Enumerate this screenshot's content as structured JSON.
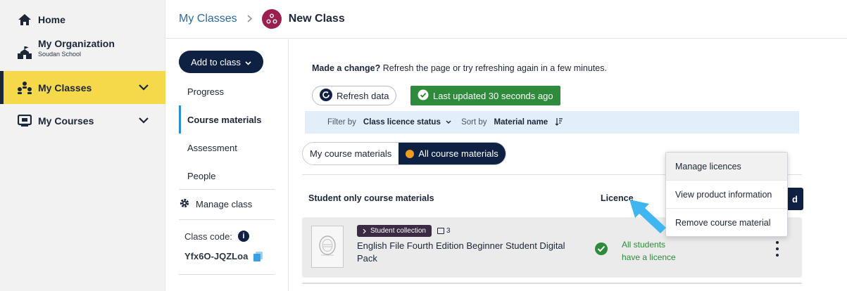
{
  "nav": {
    "home": "Home",
    "org_name": "My Organization",
    "org_school": "Soudan School",
    "classes": "My Classes",
    "courses": "My Courses"
  },
  "header": {
    "breadcrumb_parent": "My Classes",
    "breadcrumb_current": "New Class"
  },
  "class_nav": {
    "add_button": "Add to class",
    "items": [
      "Progress",
      "Course materials",
      "Assessment",
      "People"
    ],
    "manage": "Manage class",
    "code_label": "Class code:",
    "code_value": "Yfx6O-JQZLoa"
  },
  "main": {
    "notice_bold": "Made a change?",
    "notice_text": " Refresh the page or try refreshing again in a few minutes.",
    "refresh_button": "Refresh data",
    "last_updated": "Last updated 30 seconds ago",
    "filter": {
      "filter_by": "Filter by",
      "filter_value": "Class licence status",
      "sort_by": "Sort by",
      "sort_value": "Material name"
    },
    "tabs": [
      "My course materials",
      "All course materials"
    ],
    "section_title": "Student only course materials",
    "column_licence": "Licence",
    "add_partial": "d",
    "item": {
      "collection_label": "Student collection",
      "count": "3",
      "title": "English File Fourth Edition Beginner Student Digital Pack",
      "licence_status": "All students have a licence"
    },
    "menu": [
      "Manage licences",
      "View product information",
      "Remove course material"
    ]
  },
  "colors": {
    "nav_active": "#f6d94a",
    "primary_navy": "#0f2143",
    "success_green": "#2e8b3b",
    "link_blue": "#2b6ba8",
    "class_badge": "#9b1f4f",
    "pointer_arrow": "#3fb6f0"
  }
}
